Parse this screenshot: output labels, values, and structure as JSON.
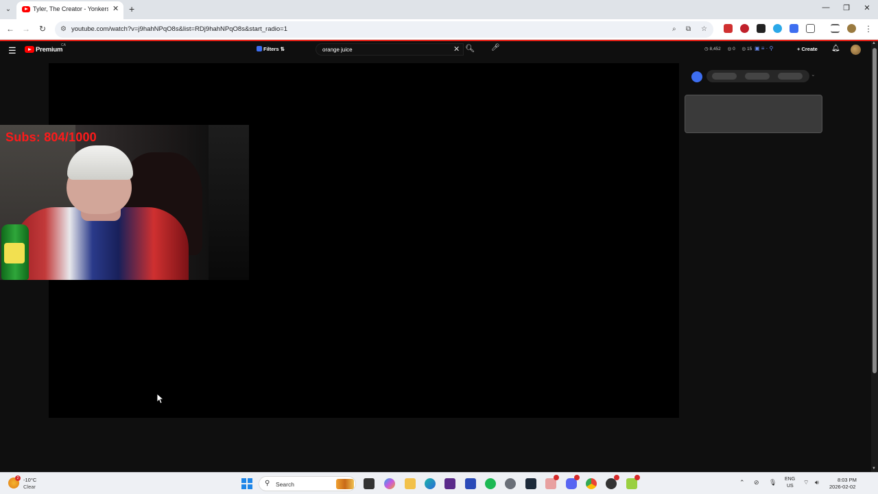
{
  "browser": {
    "tab_title": "Tyler, The Creator - Yonkers (Of",
    "url": "youtube.com/watch?v=j9hahNPqO8s&list=RDj9hahNPqO8s&start_radio=1"
  },
  "youtube": {
    "brand": "Premium",
    "country": "CA",
    "filters_label": "Filters",
    "search_value": "orange juice",
    "stats": [
      "8,452",
      "0",
      "15"
    ],
    "create_label": "Create"
  },
  "player": {
    "overlay_text": "Subs: 804/1000"
  },
  "taskbar": {
    "weather_temp": "-10°C",
    "weather_condition": "Clear",
    "weather_badge": "2",
    "search_label": "Search",
    "lang_line1": "ENG",
    "lang_line2": "US",
    "time": "8:03 PM",
    "date": "2026-02-02"
  },
  "colors": {
    "youtube_red": "#ff0000",
    "overlay_red": "#ff1a1a",
    "page_bg": "#0f0f0f",
    "accent_blue": "#3d6ef0"
  }
}
